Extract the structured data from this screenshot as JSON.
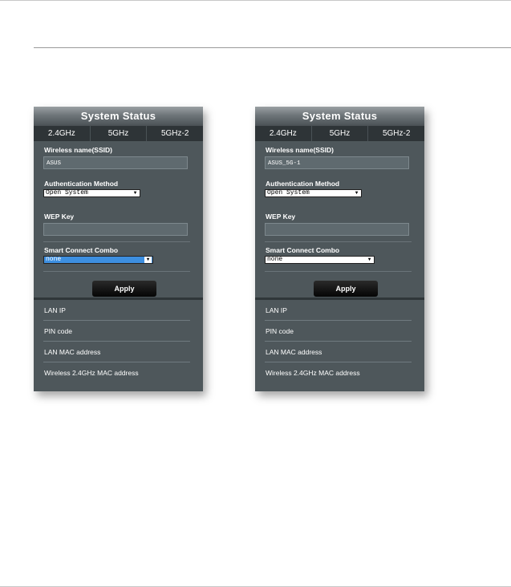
{
  "panels": [
    {
      "title": "System Status",
      "tabs": [
        "2.4GHz",
        "5GHz",
        "5GHz-2"
      ],
      "ssid_label": "Wireless name(SSID)",
      "ssid_value": "ASUS",
      "auth_label": "Authentication Method",
      "auth_value": "Open System",
      "wep_label": "WEP Key",
      "wep_value": "",
      "combo_label": "Smart Connect Combo",
      "combo_value": "none",
      "apply_label": "Apply",
      "info": [
        "LAN IP",
        "PIN code",
        "LAN MAC address",
        "Wireless 2.4GHz MAC address"
      ]
    },
    {
      "title": "System Status",
      "tabs": [
        "2.4GHz",
        "5GHz",
        "5GHz-2"
      ],
      "ssid_label": "Wireless name(SSID)",
      "ssid_value": "ASUS_5G-1",
      "auth_label": "Authentication Method",
      "auth_value": "Open System",
      "wep_label": "WEP Key",
      "wep_value": "",
      "combo_label": "Smart Connect Combo",
      "combo_value": "none",
      "apply_label": "Apply",
      "info": [
        "LAN IP",
        "PIN code",
        "LAN MAC address",
        "Wireless 2.4GHz MAC address"
      ]
    }
  ]
}
